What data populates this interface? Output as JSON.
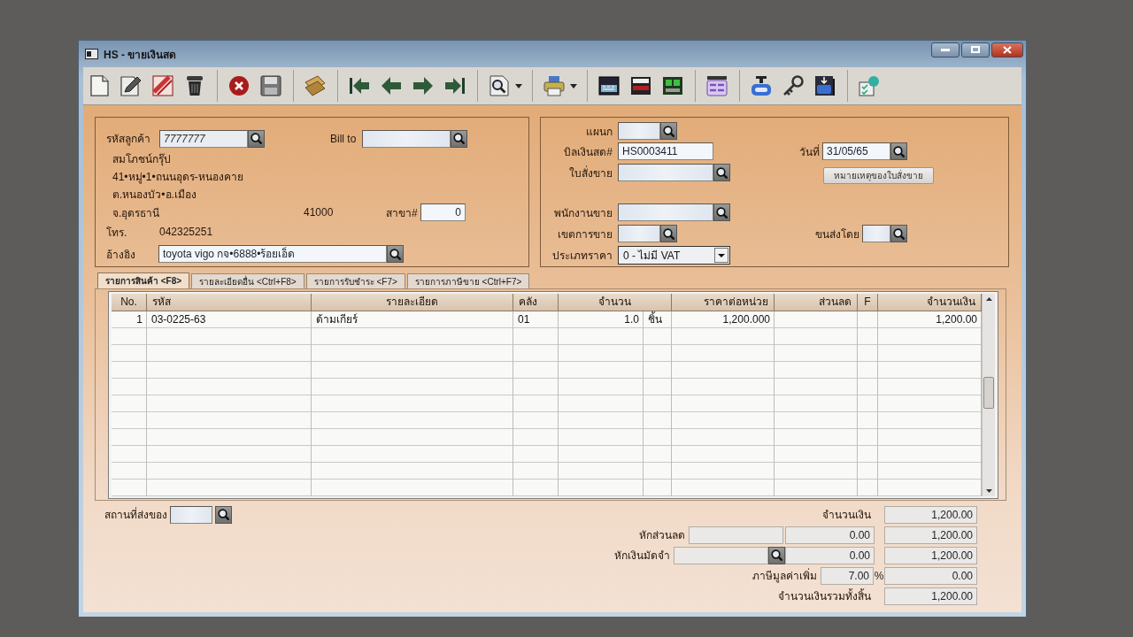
{
  "window": {
    "title": "HS - ขายเงินสด"
  },
  "customer_panel": {
    "customer_code": {
      "label": "รหัสลูกค้า",
      "value": "7777777"
    },
    "bill_to": {
      "label": "Bill to"
    },
    "customer_name": "สมโภชน์กรุ๊ป",
    "address_lines": [
      "41•หมู่•1•ถนนอุดร-หนองคาย",
      "ต.หนองบัว•อ.เมือง"
    ],
    "province": "จ.อุดรธานี",
    "postcode": "41000",
    "branch": {
      "label": "สาขา#",
      "value": "0"
    },
    "phone": {
      "label": "โทร.",
      "value": "042325251"
    },
    "reference": {
      "label": "อ้างอิง",
      "value": "toyota vigo กจ•6888•ร้อยเอ็ด"
    }
  },
  "document_panel": {
    "department": {
      "label": "แผนก"
    },
    "cash_bill_no": {
      "label": "บิลเงินสด#",
      "value": "HS0003411"
    },
    "date": {
      "label": "วันที่",
      "value": "31/05/65"
    },
    "sales_order": {
      "label": "ใบสั่งขาย"
    },
    "order_note_button": "หมายเหตุของใบสั่งขาย",
    "salesperson": {
      "label": "พนักงานขาย"
    },
    "sales_area": {
      "label": "เขตการขาย"
    },
    "shipped_by": {
      "label": "ขนส่งโดย"
    },
    "price_type": {
      "label": "ประเภทราคา",
      "value": "0 - ไม่มี VAT"
    }
  },
  "tabs": [
    {
      "label": "รายการสินค้า <F8>",
      "selected": true
    },
    {
      "label": "รายละเอียดอื่น <Ctrl+F8>",
      "selected": false
    },
    {
      "label": "รายการรับชำระ <F7>",
      "selected": false
    },
    {
      "label": "รายการภาษีขาย <Ctrl+F7>",
      "selected": false
    }
  ],
  "table": {
    "columns": [
      "No.",
      "รหัส",
      "รายละเอียด",
      "คลัง",
      "จำนวน",
      "ราคาต่อหน่วย",
      "ส่วนลด",
      "F",
      "จำนวนเงิน"
    ],
    "rows": [
      {
        "no": "1",
        "code": "03-0225-63",
        "description": "ด้ามเกียร์",
        "warehouse": "01",
        "quantity": "1.0",
        "unit": "ชิ้น",
        "unit_price": "1,200.000",
        "amount": "1,200.00"
      }
    ]
  },
  "footer": {
    "delivery_place": {
      "label": "สถานที่ส่งของ"
    },
    "totals": [
      {
        "kind": "amount",
        "label": "จำนวนเงิน",
        "value": "1,200.00"
      },
      {
        "kind": "discount",
        "label": "หักส่วนลด",
        "amount": "0.00",
        "value": "1,200.00"
      },
      {
        "kind": "deposit",
        "label": "หักเงินมัดจำ",
        "amount": "0.00",
        "value": "1,200.00"
      },
      {
        "kind": "vat",
        "label": "ภาษีมูลค่าเพิ่ม",
        "rate": "7.00",
        "unit": "%",
        "value": "0.00"
      },
      {
        "kind": "total",
        "label": "จำนวนเงินรวมทั้งสิ้น",
        "value": "1,200.00"
      }
    ]
  }
}
